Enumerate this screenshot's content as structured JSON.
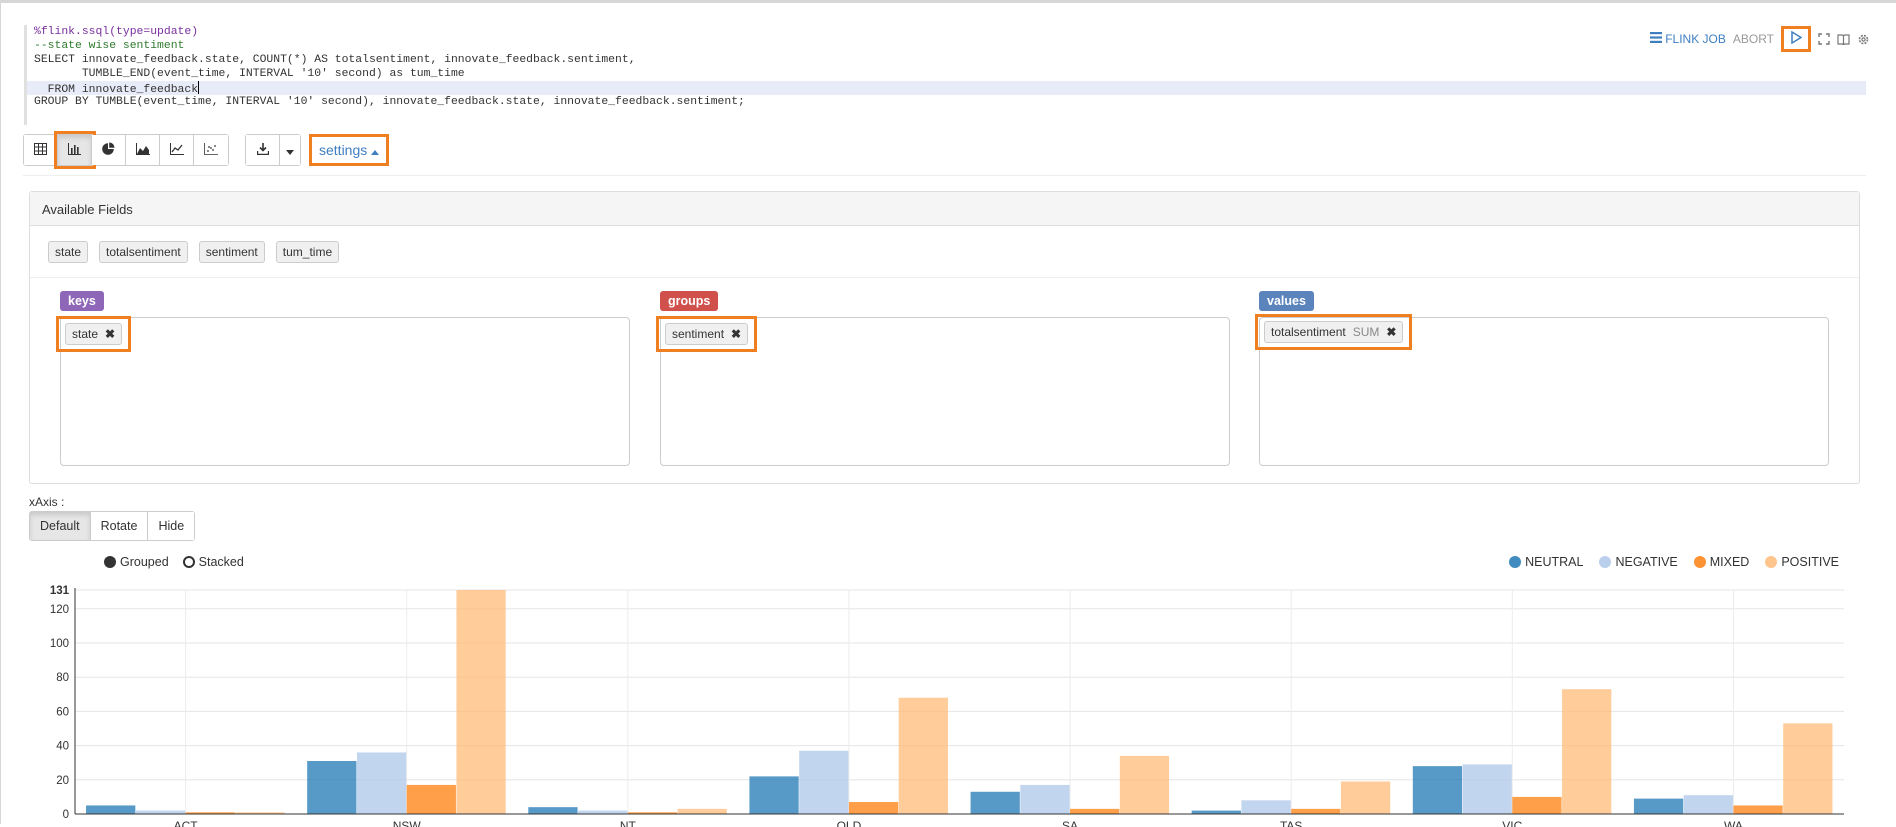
{
  "editor": {
    "lines": [
      "%flink.ssql(type=update)",
      "--state wise sentiment",
      "SELECT innovate_feedback.state, COUNT(*) AS totalsentiment, innovate_feedback.sentiment,",
      "       TUMBLE_END(event_time, INTERVAL '10' second) as tum_time",
      "  FROM innovate_feedback",
      "GROUP BY TUMBLE(event_time, INTERVAL '10' second), innovate_feedback.state, innovate_feedback.sentiment;"
    ]
  },
  "controls": {
    "flink_job": "FLINK JOB",
    "abort": "ABORT"
  },
  "toolbar": {
    "settings_label": "settings"
  },
  "settings_panel": {
    "title": "Available Fields",
    "fields": [
      "state",
      "totalsentiment",
      "sentiment",
      "tum_time"
    ],
    "keys": {
      "label": "keys",
      "items": [
        "state"
      ]
    },
    "groups": {
      "label": "groups",
      "items": [
        "sentiment"
      ]
    },
    "values": {
      "label": "values",
      "items": [
        {
          "name": "totalsentiment",
          "agg": "SUM"
        }
      ]
    }
  },
  "xaxis": {
    "label": "xAxis :",
    "options": [
      "Default",
      "Rotate",
      "Hide"
    ],
    "selected": "Default"
  },
  "chart_legend": {
    "grouped": "Grouped",
    "stacked": "Stacked"
  },
  "colors": {
    "accent": "#3f7fc1",
    "highlight": "#f07f22",
    "keys": "#8e67b8",
    "groups": "#d0504c",
    "values": "#5b83bc"
  },
  "chart_data": {
    "type": "bar",
    "mode": "grouped",
    "categories": [
      "ACT",
      "NSW",
      "NT",
      "QLD",
      "SA",
      "TAS",
      "VIC",
      "WA"
    ],
    "series": [
      {
        "name": "NEUTRAL",
        "color": "#1f77b4",
        "values": [
          5,
          31,
          4,
          22,
          13,
          2,
          28,
          9
        ]
      },
      {
        "name": "NEGATIVE",
        "color": "#aec7e8",
        "values": [
          2,
          36,
          2,
          37,
          17,
          8,
          29,
          11
        ]
      },
      {
        "name": "MIXED",
        "color": "#ff7f0e",
        "values": [
          1,
          17,
          1,
          7,
          3,
          3,
          10,
          5
        ]
      },
      {
        "name": "POSITIVE",
        "color": "#ffbb78",
        "values": [
          1,
          131,
          3,
          68,
          34,
          19,
          73,
          53
        ]
      }
    ],
    "ylim": [
      0,
      131
    ],
    "yticks": [
      0,
      20,
      40,
      60,
      80,
      100,
      120,
      131
    ],
    "grid": true,
    "legend": "top-right"
  }
}
